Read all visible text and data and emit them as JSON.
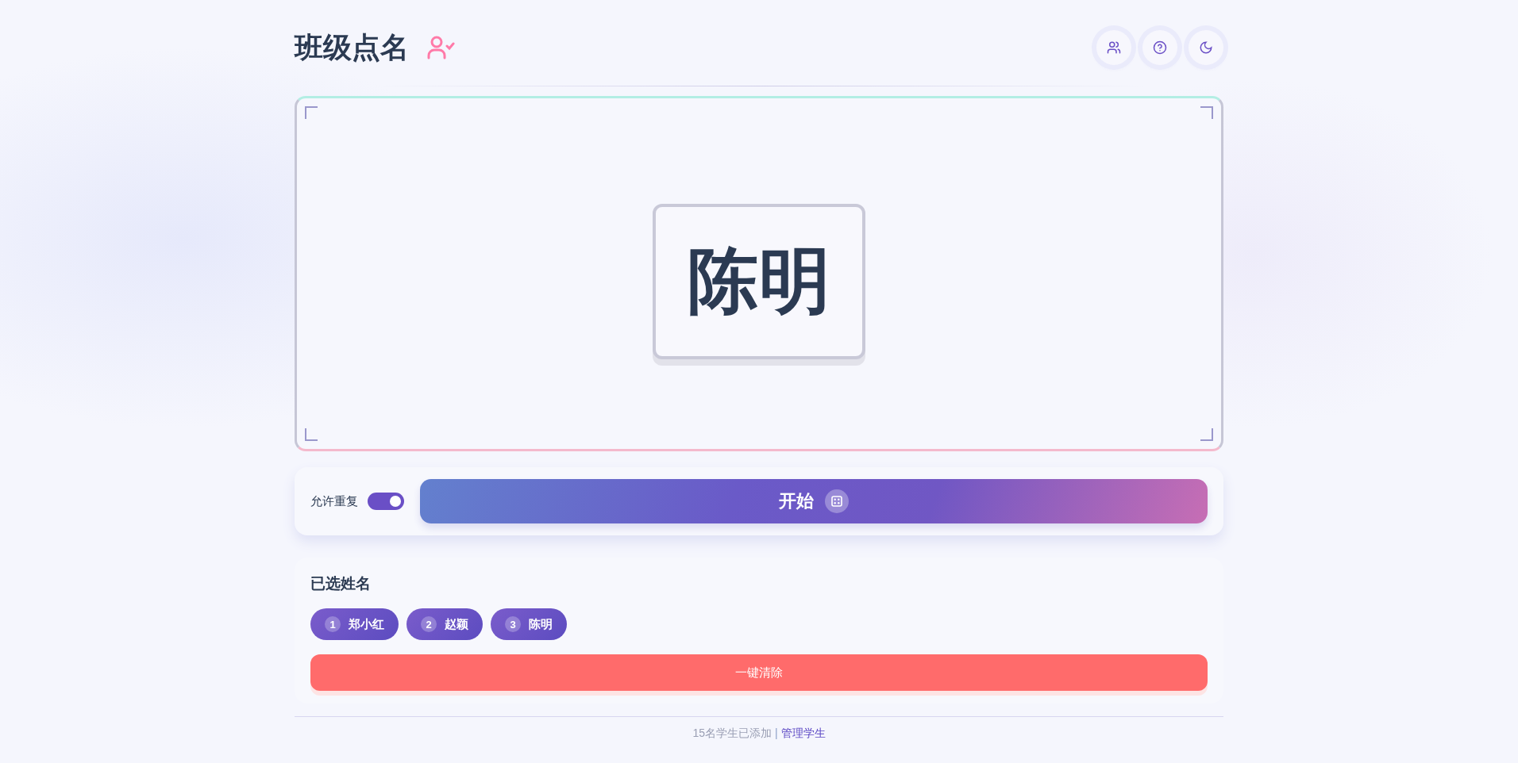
{
  "header": {
    "title": "班级点名"
  },
  "toolbar": [
    {
      "kind": "students"
    },
    {
      "kind": "help"
    },
    {
      "kind": "theme"
    }
  ],
  "stage": {
    "name": "陈明"
  },
  "controls": {
    "repeat": {
      "label": "允许重复",
      "on": true
    },
    "start_button": "开始"
  },
  "selected": {
    "title": "已选姓名",
    "items": [
      {
        "index": "1",
        "name": "郑小红"
      },
      {
        "index": "2",
        "name": "赵颖"
      },
      {
        "index": "3",
        "name": "陈明"
      }
    ],
    "clear_button": "一键清除"
  },
  "footer": {
    "status": "15名学生已添加",
    "separator": "|",
    "link": "管理学生"
  }
}
